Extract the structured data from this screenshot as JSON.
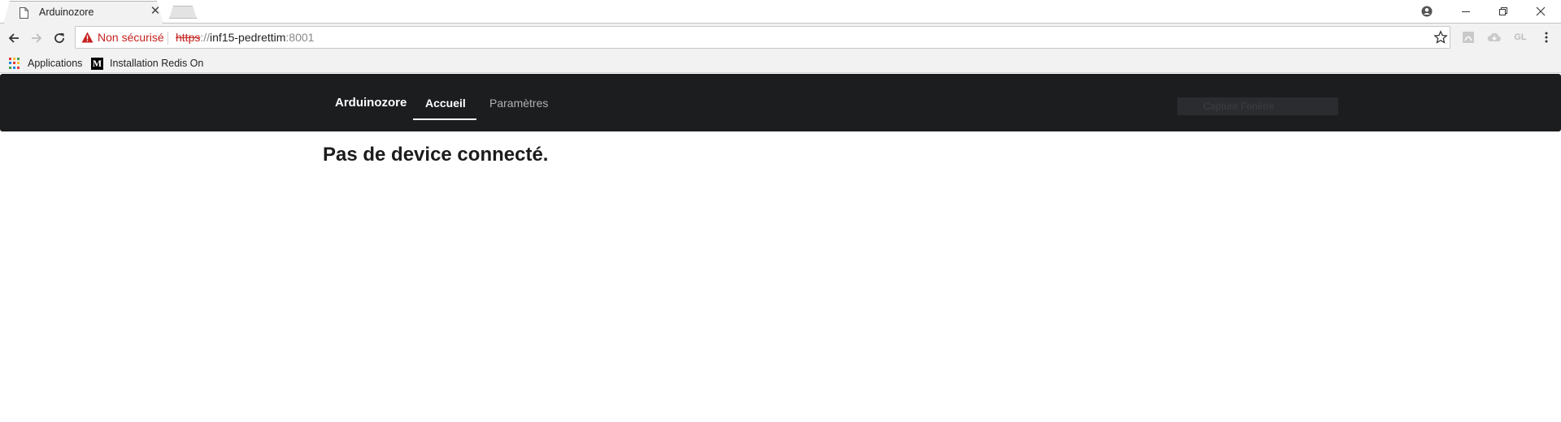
{
  "browser": {
    "tab": {
      "title": "Arduinozore",
      "close": "✕"
    },
    "address": {
      "warning": "Non sécurisé",
      "scheme": "https",
      "separator": "://",
      "host": "inf15-pedrettim",
      "port": ":8001"
    },
    "extensions": [
      "adobe-icon",
      "cloud-icon",
      "GL"
    ],
    "bookmarks": [
      {
        "label": "Applications",
        "icon": "apps-grid-icon"
      },
      {
        "label": "Installation Redis On",
        "icon": "medium-logo-icon"
      }
    ]
  },
  "navbar": {
    "brand": "Arduinozore",
    "links": [
      {
        "label": "Accueil",
        "active": true
      },
      {
        "label": "Paramètres",
        "active": false
      }
    ],
    "capture_label": "Capture Fenêtre"
  },
  "main": {
    "heading": "Pas de device connecté."
  },
  "colors": {
    "navbar_bg": "#1c1d1f",
    "warning_red": "#c5221f"
  }
}
